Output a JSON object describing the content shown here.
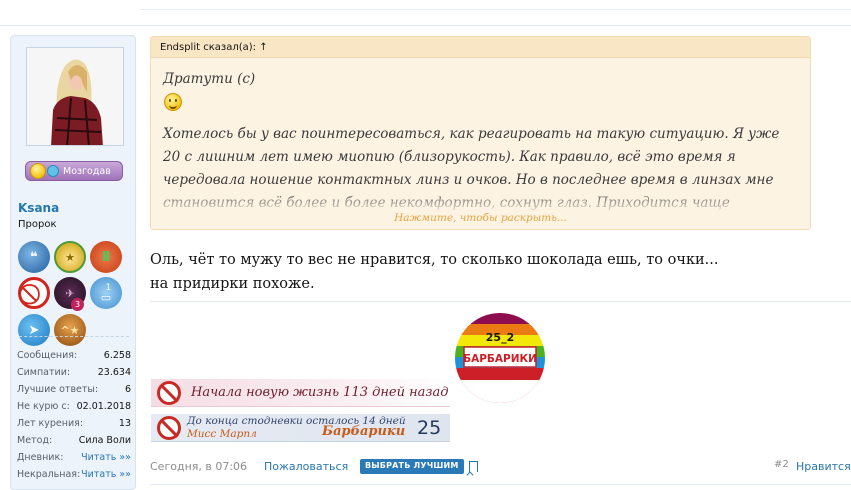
{
  "user": {
    "name": "Ksana",
    "title": "Пророк",
    "mozgo_label": "Мозгодав",
    "badges": [
      {
        "icon": "chat-bubbles-icon"
      },
      {
        "icon": "medal-icon"
      },
      {
        "icon": "rank-stripes-icon"
      },
      {
        "icon": "no-smoking-icon"
      },
      {
        "icon": "helicopter-icon",
        "count": "3"
      },
      {
        "icon": "book-icon",
        "count": "1"
      },
      {
        "icon": "send-arrow-icon"
      },
      {
        "icon": "rank-star-icon"
      }
    ],
    "stats": [
      {
        "label": "Сообщения:",
        "value": "6.258"
      },
      {
        "label": "Симпатии:",
        "value": "23.634"
      },
      {
        "label": "Лучшие ответы:",
        "value": "6"
      },
      {
        "label": "Не курю с:",
        "value": "02.01.2018"
      },
      {
        "label": "Лет курения:",
        "value": "13"
      },
      {
        "label": "Метод:",
        "value": "Сила Воли"
      },
      {
        "label": "Дневник:",
        "value": "Читать »»"
      },
      {
        "label": "Некральная:",
        "value": "Читать »»"
      }
    ]
  },
  "quote": {
    "author": "Endsplit сказал(а): ↑",
    "line1": "Дратути (с)",
    "para": "Хотелось бы у вас поинтересоваться, как реагировать на такую ситуацию. Я уже 20 с лишним лет имею миопию (близорукость). Как правило, всё это время я чередовала ношение контактных линз и очков. Но в последнее время в линзах мне становится всё более и более некомфортно, сохнут глаз. Приходится чаще",
    "expand": "Нажмите, чтобы раскрыть..."
  },
  "message": {
    "line1": "Оль, чёт то мужу то вес не нравится, то сколько шоколада ешь, то очки...",
    "line2": "на придирки похоже."
  },
  "logo": {
    "number": "25_2",
    "word": "БАРБАРИКИ"
  },
  "signature": {
    "bar1_text": "Начала новую жизнь 113 дней назад",
    "bar2_line1": "До конца стодневки осталось 14 дней",
    "bar2_line2": "Мисс Марпл",
    "bar2_team": "Барбарики",
    "bar2_number": "25"
  },
  "footer": {
    "date": "Сегодня, в 07:06",
    "report": "Пожаловаться",
    "best": "ВЫБРАТЬ ЛУЧШИМ",
    "post_num": "#2",
    "like": "Нравится"
  },
  "colors": {
    "link": "#2577b1",
    "quote_bg": "#fdf3e3",
    "panel_bg": "#edf3fb"
  }
}
